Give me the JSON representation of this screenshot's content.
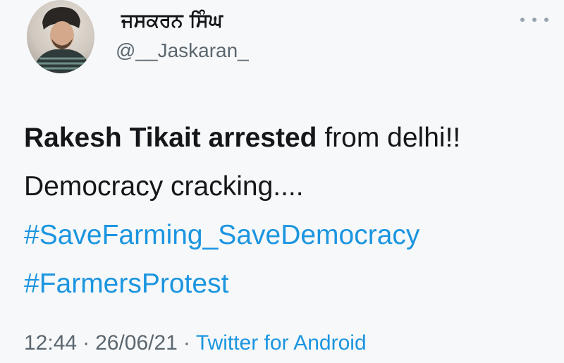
{
  "author": {
    "display_name": "ਜਸਕਰਨ ਸਿੰਘ",
    "handle": "@__Jaskaran_"
  },
  "tweet": {
    "line1_bold": "Rakesh Tikait arrested",
    "line1_rest": " from delhi!!",
    "line2": "Democracy cracking....",
    "hashtag1": "#SaveFarming_SaveDemocracy",
    "hashtag2": "#FarmersProtest"
  },
  "meta": {
    "time": "12:44",
    "separator": "·",
    "date": "26/06/21",
    "source": "Twitter for Android"
  },
  "icons": {
    "more": "more-horizontal-icon",
    "avatar": "profile-photo"
  },
  "colors": {
    "link": "#1b95e0",
    "secondary_text": "#5b6770",
    "primary_text": "#14171a",
    "background": "#f7f8f9"
  }
}
